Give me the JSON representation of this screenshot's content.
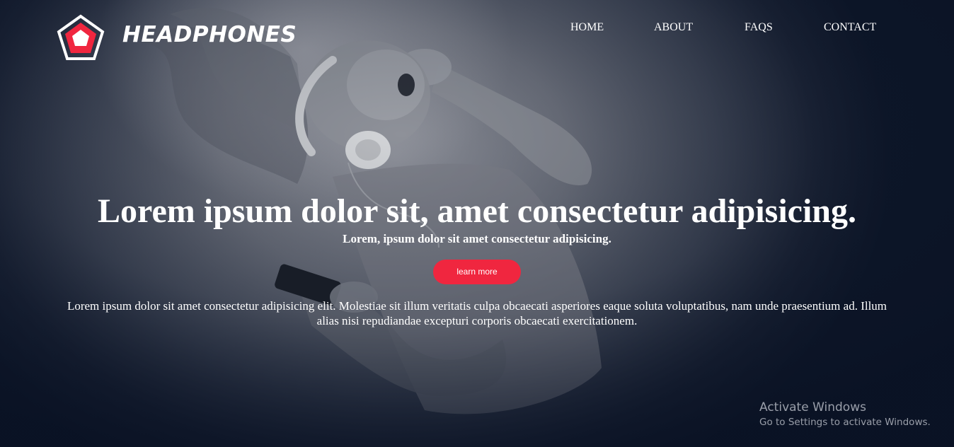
{
  "header": {
    "brand": "HEADPHONES",
    "logo_icon": "pentagon-logo-icon",
    "nav": [
      {
        "label": "HOME"
      },
      {
        "label": "ABOUT"
      },
      {
        "label": "FAQS"
      },
      {
        "label": "CONTACT"
      }
    ]
  },
  "hero": {
    "headline": "Lorem ipsum dolor sit, amet consectetur adipisicing.",
    "subhead": "Lorem, ipsum dolor sit amet consectetur adipisicing.",
    "cta_label": "learn more",
    "body": "Lorem ipsum dolor sit amet consectetur adipisicing elit. Molestiae sit illum veritatis culpa obcaecati asperiores eaque soluta voluptatibus, nam unde praesentium ad. Illum alias nisi repudiandae excepturi corporis obcaecati exercitationem."
  },
  "watermark": {
    "title": "Activate Windows",
    "subtitle": "Go to Settings to activate Windows."
  },
  "colors": {
    "accent": "#f0263f",
    "text": "#ffffff",
    "background_dark": "#0d1628"
  }
}
